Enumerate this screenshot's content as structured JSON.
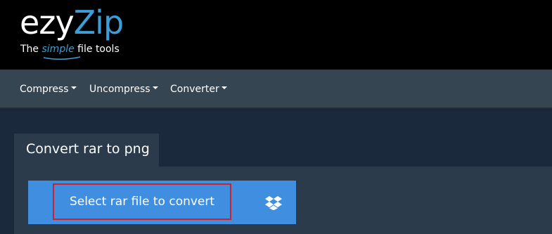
{
  "logo": {
    "ezy": "ezy",
    "zip": "Zip",
    "tagline_prefix": "The ",
    "tagline_accent": "simple",
    "tagline_suffix": " file tools",
    "accent_color": "#3a9fd6"
  },
  "nav": {
    "items": [
      {
        "label": "Compress"
      },
      {
        "label": "Uncompress"
      },
      {
        "label": "Converter"
      }
    ]
  },
  "tool": {
    "tab_label": "Convert rar to png",
    "select_label": "Select rar file to convert",
    "button_color": "#3f8ee0",
    "dropbox_icon": "dropbox-icon"
  }
}
